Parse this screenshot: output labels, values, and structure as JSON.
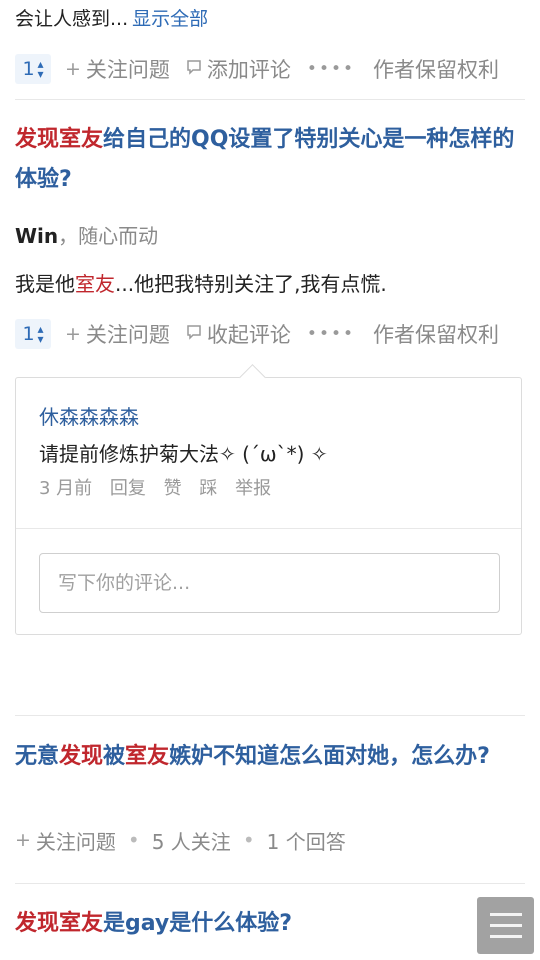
{
  "top_snippet": {
    "text": "会让人感到...",
    "show_all": "显示全部"
  },
  "item1_actions": {
    "vote": "1",
    "follow": "关注问题",
    "comment": "添加评论",
    "rights": "作者保留权利"
  },
  "question2": {
    "title_hl1": "发现室友",
    "title_rest": "给自己的QQ设置了特别关心是一种怎样的体验?",
    "author_name": "Win",
    "author_bio": "，随心而动",
    "answer_pre": "我是他",
    "answer_hl": "室友",
    "answer_post": "...他把我特别关注了,我有点慌."
  },
  "item2_actions": {
    "vote": "1",
    "follow": "关注问题",
    "comment": "收起评论",
    "rights": "作者保留权利"
  },
  "comment": {
    "user": "休森森森森",
    "text": "请提前修炼护菊大法✧ (´ω`*) ✧",
    "time": "3 月前",
    "reply": "回复",
    "like": "赞",
    "dislike": "踩",
    "report": "举报",
    "input_placeholder": "写下你的评论..."
  },
  "question3": {
    "t1": "无意",
    "t2": "发现",
    "t3": "被",
    "t4": "室友",
    "t5": "嫉妒不知道怎么面对她，怎么办?",
    "follow": "关注问题",
    "followers": "5 人关注",
    "answers": "1 个回答"
  },
  "question4": {
    "t1": "发现室友",
    "t2": "是gay是什么体验?"
  },
  "colors": {
    "link": "#2e5f9e",
    "highlight": "#c0272d",
    "muted": "#8a8a8a"
  },
  "icons": {
    "follow": "plus-icon",
    "comment": "comment-icon",
    "more": "more-dots-icon",
    "menu": "menu-icon"
  }
}
